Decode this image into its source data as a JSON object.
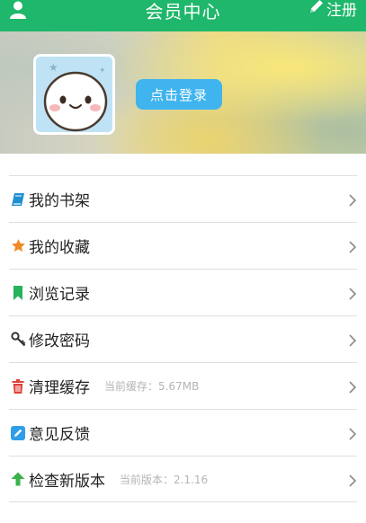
{
  "header": {
    "title": "会员中心",
    "register_label": "注册"
  },
  "banner": {
    "login_label": "点击登录"
  },
  "menu": {
    "items": [
      {
        "label": "我的书架",
        "icon": "book-icon",
        "sub": ""
      },
      {
        "label": "我的收藏",
        "icon": "star-icon",
        "sub": ""
      },
      {
        "label": "浏览记录",
        "icon": "bookmark-icon",
        "sub": ""
      },
      {
        "label": "修改密码",
        "icon": "key-icon",
        "sub": ""
      },
      {
        "label": "清理缓存",
        "icon": "trash-icon",
        "sub": "当前缓存：5.67MB"
      },
      {
        "label": "意见反馈",
        "icon": "edit-icon",
        "sub": ""
      },
      {
        "label": "检查新版本",
        "icon": "arrow-up-icon",
        "sub": "当前版本：2.1.16"
      }
    ]
  },
  "colors": {
    "header_bg": "#1fb76b",
    "login_button": "#3fb4ef",
    "book_icon": "#1f8fd0",
    "star_icon": "#f08a24",
    "bookmark_icon": "#26b35c",
    "key_icon": "#333333",
    "trash_icon": "#e0433a",
    "edit_icon": "#2f9ee8",
    "arrow_up_icon": "#3bb14a"
  }
}
